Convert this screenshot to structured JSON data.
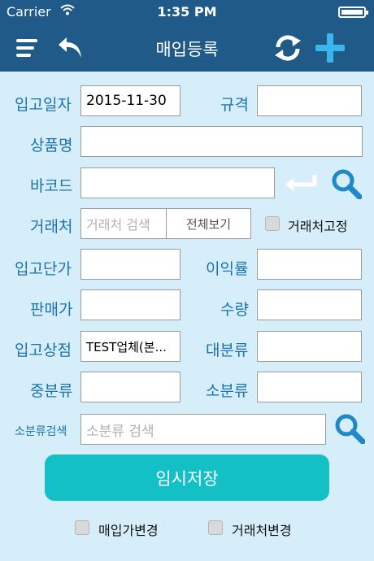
{
  "status": {
    "carrier": "Carrier",
    "time": "1:35 PM"
  },
  "nav": {
    "title": "매입등록",
    "icons": [
      "hamburger-menu-icon",
      "back-arrow-icon",
      "refresh-icon",
      "plus-icon"
    ]
  },
  "form": {
    "labels": {
      "date": "입고일자",
      "spec": "규격",
      "product": "상품명",
      "barcode": "바코드",
      "vendor": "거래처",
      "unit_price": "입고단가",
      "profit_rate": "이익률",
      "sale_price": "판매가",
      "quantity": "수량",
      "store": "입고상점",
      "major_cat": "대분류",
      "mid_cat": "중분류",
      "minor_cat": "소분류",
      "minor_search": "소분류검색"
    },
    "values": {
      "date": "2015-11-30",
      "store": "TEST업체(본..."
    },
    "placeholders": {
      "vendor_search": "거래처 검색",
      "minor_search": "소분류 검색"
    },
    "view_all_label": "전체보기",
    "vendor_fixed_label": "거래처고정"
  },
  "save_label": "임시저장",
  "bottom_options": {
    "purchase_price_change": "매입가변경",
    "vendor_change": "거래처변경"
  },
  "colors": {
    "bar": "#1f5a88",
    "background": "#d6eefa",
    "label": "#1b72ae",
    "accent": "#12c0c6",
    "icon_blue": "#1e88c9"
  }
}
